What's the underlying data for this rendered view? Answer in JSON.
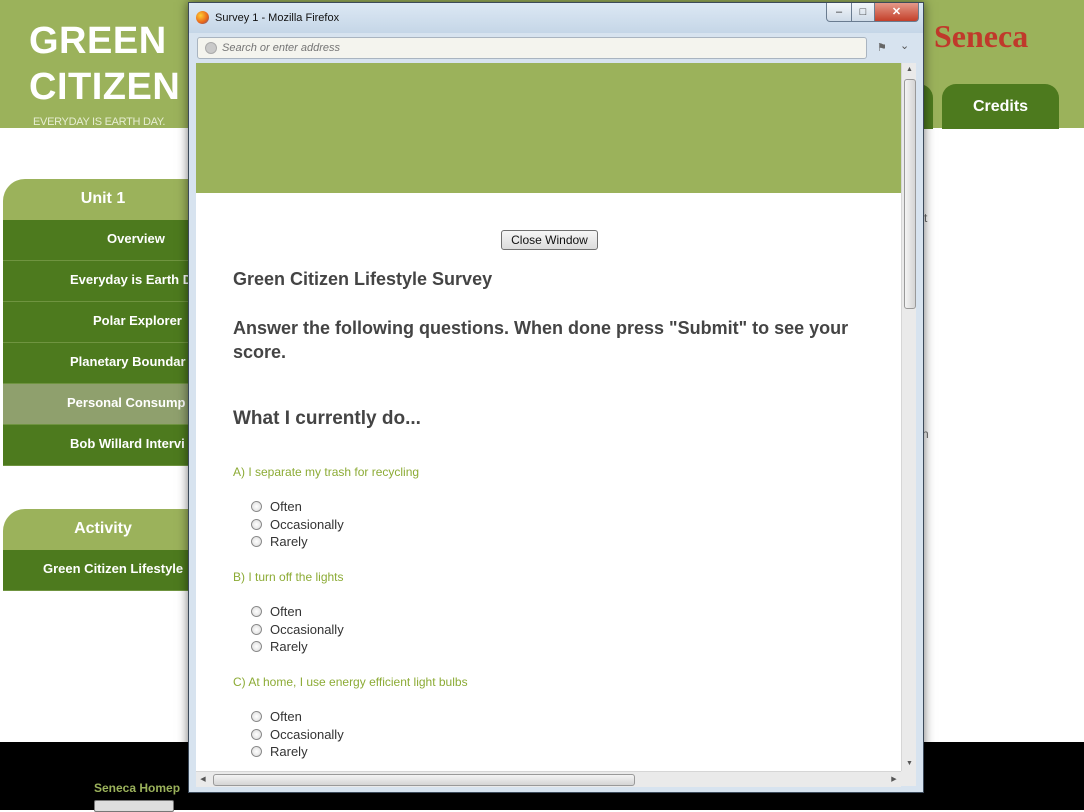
{
  "site": {
    "brand_line1": "GREEN",
    "brand_line2": "CITIZEN",
    "tagline": "EVERYDAY IS EARTH DAY.",
    "partner_logo": "Seneca",
    "header_tab": "Credits",
    "colors": {
      "header_green": "#9bb25b",
      "nav_dark_green": "#4d7a1e",
      "question_green": "#8cab35",
      "logo_red": "#c0392b"
    },
    "unit_nav": {
      "heading": "Unit 1",
      "items": [
        "Overview",
        "Everyday is Earth D",
        "Polar Explorer",
        "Planetary Boundar",
        "Personal Consump",
        "Bob Willard Intervi"
      ],
      "active_index": 4
    },
    "activity_nav": {
      "heading": "Activity",
      "items": [
        "Green Citizen Lifestyle"
      ]
    },
    "stray_chars": [
      "t",
      "n"
    ],
    "footer_link": "Seneca Homep"
  },
  "popup": {
    "window_title": "Survey 1 - Mozilla Firefox",
    "icons": [
      "firefox-icon",
      "minimize-icon",
      "maximize-icon",
      "close-icon",
      "lock-icon",
      "puzzle-icon",
      "dropdown-icon"
    ],
    "address_placeholder": "Search or enter address",
    "close_window_label": "Close Window",
    "survey_title": "Green Citizen Lifestyle Survey",
    "instruction": "Answer the following questions. When done press \"Submit\" to see your score.",
    "section_heading": "What I currently do...",
    "questions": [
      {
        "text": "A) I separate my trash for recycling",
        "options": [
          "Often",
          "Occasionally",
          "Rarely"
        ]
      },
      {
        "text": "B) I turn off the lights",
        "options": [
          "Often",
          "Occasionally",
          "Rarely"
        ]
      },
      {
        "text": "C) At home, I use energy efficient light bulbs",
        "options": [
          "Often",
          "Occasionally",
          "Rarely"
        ]
      }
    ]
  }
}
